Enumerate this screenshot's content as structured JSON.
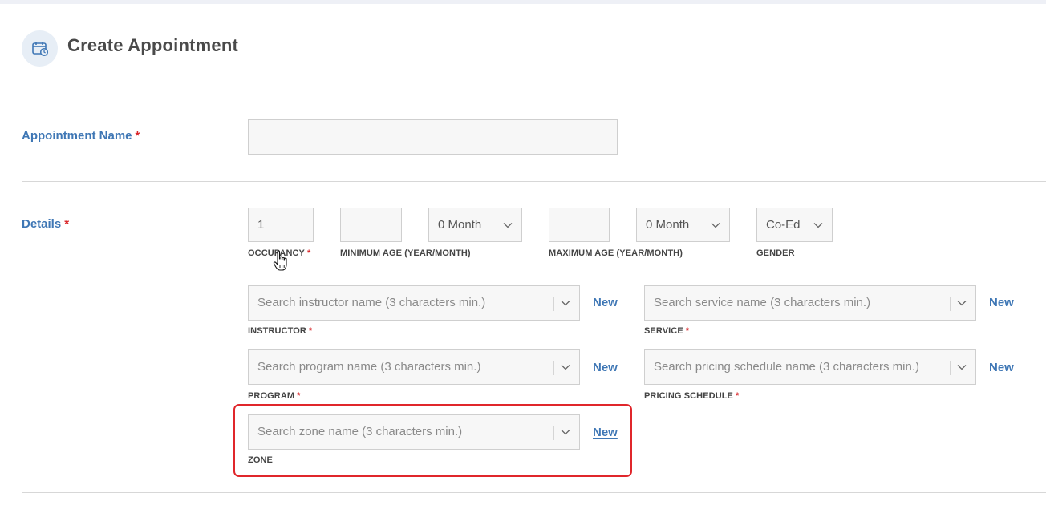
{
  "header": {
    "title": "Create Appointment",
    "icon": "calendar-clock-icon"
  },
  "appointment_name": {
    "label": "Appointment Name",
    "required_mark": "*",
    "value": ""
  },
  "details": {
    "label": "Details",
    "required_mark": "*",
    "occupancy": {
      "value": "1",
      "label": "OCCUPANCY",
      "required_mark": "*"
    },
    "minimum_age": {
      "year_value": "",
      "month_value": "0 Month",
      "label": "MINIMUM AGE (YEAR/MONTH)"
    },
    "maximum_age": {
      "year_value": "",
      "month_value": "0 Month",
      "label": "MAXIMUM AGE (YEAR/MONTH)"
    },
    "gender": {
      "value": "Co-Ed",
      "label": "GENDER"
    }
  },
  "instructor": {
    "placeholder": "Search instructor name (3 characters min.)",
    "label": "INSTRUCTOR",
    "required_mark": "*",
    "new_label": "New"
  },
  "service": {
    "placeholder": "Search service name (3 characters min.)",
    "label": "SERVICE",
    "required_mark": "*",
    "new_label": "New"
  },
  "program": {
    "placeholder": "Search program name (3 characters min.)",
    "label": "PROGRAM",
    "required_mark": "*",
    "new_label": "New"
  },
  "pricing_schedule": {
    "placeholder": "Search pricing schedule name (3 characters min.)",
    "label": "PRICING SCHEDULE",
    "required_mark": "*",
    "new_label": "New"
  },
  "zone": {
    "placeholder": "Search zone name (3 characters min.)",
    "label": "ZONE",
    "new_label": "New"
  },
  "colors": {
    "accent": "#3f77b5",
    "required": "#d9262a",
    "highlight": "#e0262b"
  }
}
